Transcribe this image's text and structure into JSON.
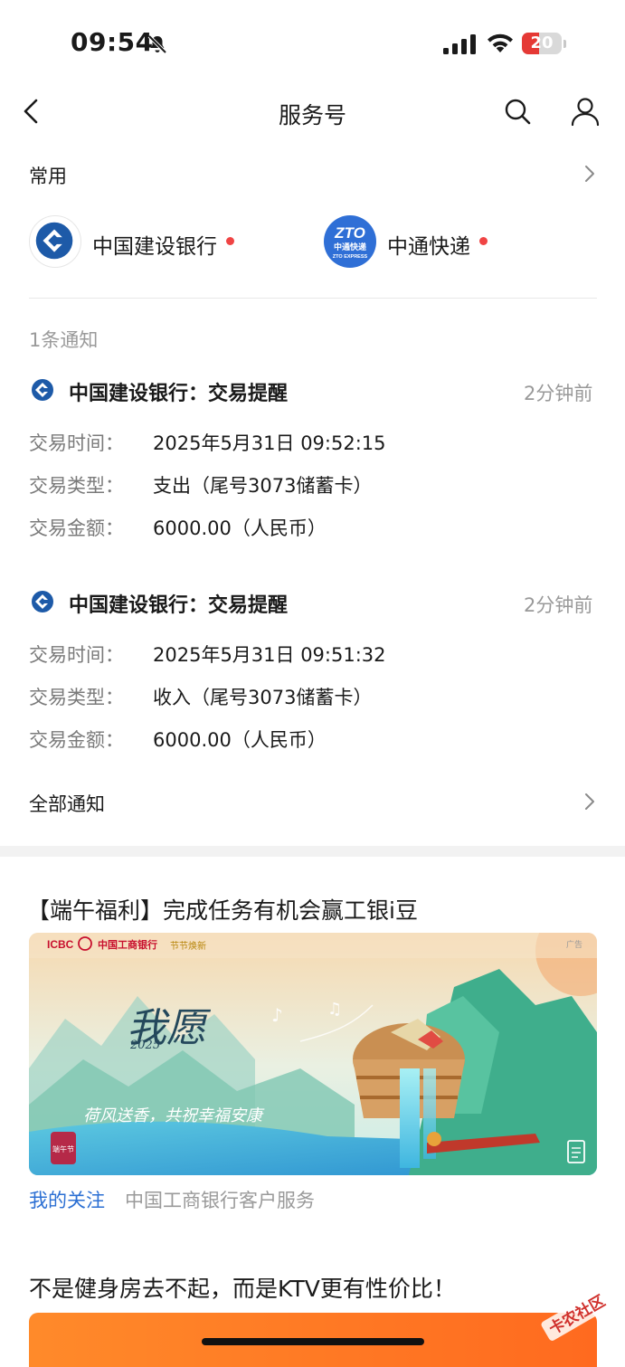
{
  "status_bar": {
    "time": "09:54",
    "battery_level": "20",
    "battery_fraction": 0.2
  },
  "nav": {
    "title": "服务号"
  },
  "frequent": {
    "title": "常用",
    "items": [
      {
        "name": "中国建设银行",
        "unread": true
      },
      {
        "name": "中通快递",
        "unread": true,
        "logo_text": "ZTO",
        "logo_sub1": "中通快递",
        "logo_sub2": "ZTO EXPRESS"
      }
    ]
  },
  "notice_count": "1条通知",
  "messages": [
    {
      "title": "中国建设银行：交易提醒",
      "time": "2分钟前",
      "rows": [
        {
          "label": "交易时间：",
          "value": "2025年5月31日 09:52:15"
        },
        {
          "label": "交易类型：",
          "value": "支出（尾号3073储蓄卡）"
        },
        {
          "label": "交易金额：",
          "value": "6000.00（人民币）"
        }
      ]
    },
    {
      "title": "中国建设银行：交易提醒",
      "time": "2分钟前",
      "rows": [
        {
          "label": "交易时间：",
          "value": "2025年5月31日 09:51:32"
        },
        {
          "label": "交易类型：",
          "value": "收入（尾号3073储蓄卡）"
        },
        {
          "label": "交易金额：",
          "value": "6000.00（人民币）"
        }
      ]
    }
  ],
  "all_notices": "全部通知",
  "promo": {
    "title": "【端午福利】完成任务有机会赢工银i豆",
    "banner": {
      "brand": "ICBC",
      "bank": "中国工商银行",
      "slogan": "节节焕新",
      "ad_tag": "广告",
      "headline": "我愿",
      "year": "2025",
      "caption": "荷风送香，共祝幸福安康",
      "seal": "端午节"
    },
    "follow_label": "我的关注",
    "account": "中国工商银行客户服务"
  },
  "article": {
    "title": "不是健身房去不起，而是KTV更有性价比！"
  },
  "watermark": {
    "text": "卡农社区"
  },
  "colors": {
    "accent": "#2b6fd3",
    "ccb_blue": "#1d5aa8",
    "zto_blue": "#2f6fd6",
    "unread_dot": "#f04444",
    "battery_red": "#e53935"
  }
}
